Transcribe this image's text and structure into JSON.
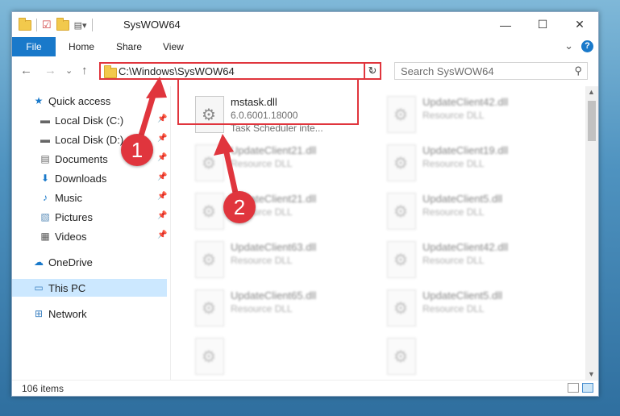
{
  "window": {
    "title": "SysWOW64",
    "controls": {
      "minimize": "—",
      "maximize": "☐",
      "close": "✕"
    }
  },
  "ribbon": {
    "tabs": [
      {
        "label": "File"
      },
      {
        "label": "Home"
      },
      {
        "label": "Share"
      },
      {
        "label": "View"
      }
    ],
    "expand_glyph": "⌄",
    "help_glyph": "?"
  },
  "nav": {
    "back": "←",
    "forward": "→",
    "recent": "⌄",
    "up": "↑"
  },
  "address": {
    "path": "C:\\Windows\\SysWOW64",
    "dropdown": "⌄",
    "refresh": "↻"
  },
  "search": {
    "placeholder": "Search SysWOW64",
    "icon": "⚲"
  },
  "sidebar": {
    "items": [
      {
        "label": "Quick access",
        "icon": "star-icon",
        "glyph": "★",
        "pinned": false
      },
      {
        "label": "Local Disk (C:)",
        "icon": "drive-icon",
        "glyph": "▬",
        "pinned": true
      },
      {
        "label": "Local Disk (D:)",
        "icon": "drive-icon",
        "glyph": "▬",
        "pinned": true
      },
      {
        "label": "Documents",
        "icon": "documents-icon",
        "glyph": "▤",
        "pinned": true
      },
      {
        "label": "Downloads",
        "icon": "downloads-icon",
        "glyph": "⬇",
        "pinned": true
      },
      {
        "label": "Music",
        "icon": "music-icon",
        "glyph": "♪",
        "pinned": true
      },
      {
        "label": "Pictures",
        "icon": "pictures-icon",
        "glyph": "▧",
        "pinned": true
      },
      {
        "label": "Videos",
        "icon": "videos-icon",
        "glyph": "▦",
        "pinned": true
      },
      {
        "label": "OneDrive",
        "icon": "onedrive-icon",
        "glyph": "☁",
        "pinned": false
      },
      {
        "label": "This PC",
        "icon": "pc-icon",
        "glyph": "▭",
        "pinned": false
      },
      {
        "label": "Network",
        "icon": "network-icon",
        "glyph": "⊞",
        "pinned": false
      }
    ],
    "pin_glyph": "📌"
  },
  "files": {
    "selected": {
      "name": "mstask.dll",
      "version": "6.0.6001.18000",
      "description": "Task Scheduler inte..."
    },
    "blurred": [
      {
        "name": "UpdateClient42.dll",
        "type": "Resource DLL"
      },
      {
        "name": "UpdateClient21.dll",
        "type": "Resource DLL"
      },
      {
        "name": "UpdateClient19.dll",
        "type": "Resource DLL"
      },
      {
        "name": "UpdateClient21.dll",
        "type": "Resource DLL"
      },
      {
        "name": "UpdateClient5.dll",
        "type": "Resource DLL"
      },
      {
        "name": "UpdateClient63.dll",
        "type": "Resource DLL"
      },
      {
        "name": "UpdateClient42.dll",
        "type": "Resource DLL"
      },
      {
        "name": "UpdateClient65.dll",
        "type": "Resource DLL"
      },
      {
        "name": "UpdateClient5.dll",
        "type": "Resource DLL"
      }
    ]
  },
  "status": {
    "count": "106 items"
  },
  "callouts": {
    "first": "1",
    "second": "2"
  },
  "colors": {
    "accent": "#1979ca",
    "annotation": "#e0353d",
    "selected_bg": "#cce8ff"
  }
}
